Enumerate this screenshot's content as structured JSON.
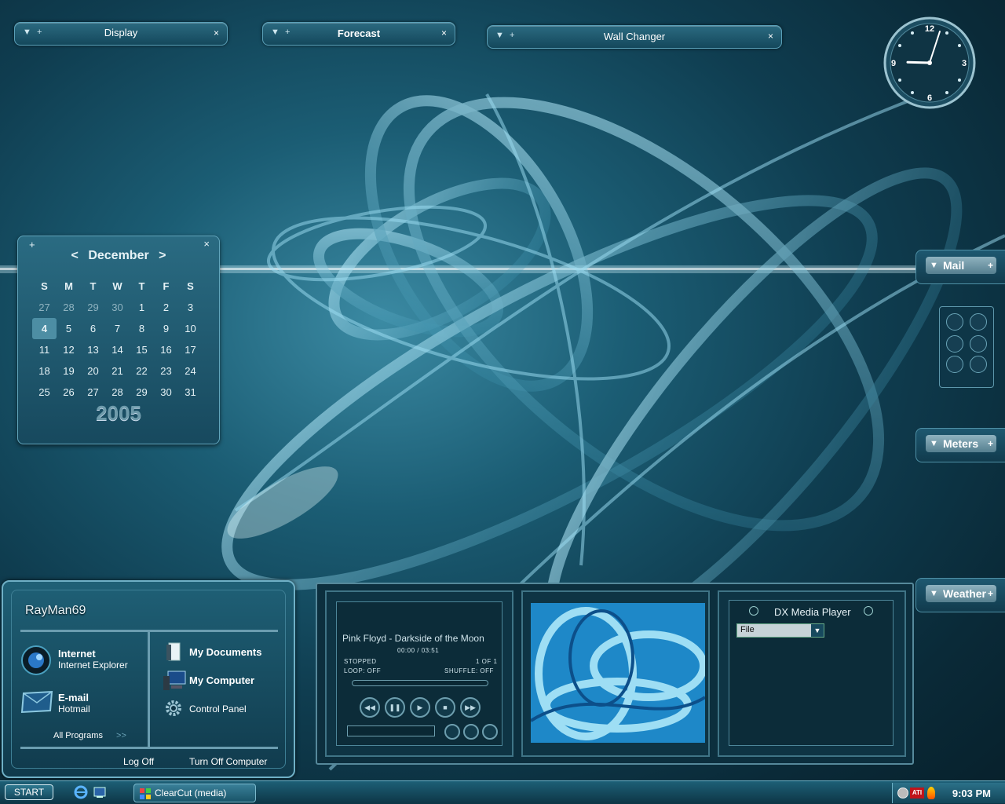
{
  "gadgets": {
    "display": {
      "title": "Display"
    },
    "forecast": {
      "title": "Forecast"
    },
    "wallchanger": {
      "title": "Wall Changer"
    },
    "close_glyph": "×",
    "menu_glyph": "▼",
    "add_glyph": "+"
  },
  "clock": {
    "numerals": [
      "12",
      "3",
      "6",
      "9"
    ],
    "hour": 9,
    "minute": 3
  },
  "calendar": {
    "prev": "<",
    "month": "December",
    "next": ">",
    "year": "2005",
    "weekdays": [
      "S",
      "M",
      "T",
      "W",
      "T",
      "F",
      "S"
    ],
    "weeks": [
      [
        {
          "d": "27",
          "other": true
        },
        {
          "d": "28",
          "other": true
        },
        {
          "d": "29",
          "other": true
        },
        {
          "d": "30",
          "other": true
        },
        {
          "d": "1"
        },
        {
          "d": "2"
        },
        {
          "d": "3"
        }
      ],
      [
        {
          "d": "4",
          "today": true
        },
        {
          "d": "5"
        },
        {
          "d": "6"
        },
        {
          "d": "7"
        },
        {
          "d": "8"
        },
        {
          "d": "9"
        },
        {
          "d": "10"
        }
      ],
      [
        {
          "d": "11"
        },
        {
          "d": "12"
        },
        {
          "d": "13"
        },
        {
          "d": "14"
        },
        {
          "d": "15"
        },
        {
          "d": "16"
        },
        {
          "d": "17"
        }
      ],
      [
        {
          "d": "18"
        },
        {
          "d": "19"
        },
        {
          "d": "20"
        },
        {
          "d": "21"
        },
        {
          "d": "22"
        },
        {
          "d": "23"
        },
        {
          "d": "24"
        }
      ],
      [
        {
          "d": "25"
        },
        {
          "d": "26"
        },
        {
          "d": "27"
        },
        {
          "d": "28"
        },
        {
          "d": "29"
        },
        {
          "d": "30"
        },
        {
          "d": "31"
        }
      ]
    ]
  },
  "docks": {
    "mail": "Mail",
    "meters": "Meters",
    "weather": "Weather"
  },
  "startmenu": {
    "user": "RayMan69",
    "internet": {
      "title": "Internet",
      "sub": "Internet Explorer"
    },
    "email": {
      "title": "E-mail",
      "sub": "Hotmail"
    },
    "all_programs": "All Programs",
    "all_programs_arrow": ">>",
    "my_documents": "My Documents",
    "my_computer": "My Computer",
    "control_panel": "Control Panel",
    "log_off": "Log Off",
    "turn_off": "Turn Off Computer"
  },
  "media": {
    "track": "Pink Floyd - Darkside of the Moon",
    "time": "00:00 / 03:51",
    "status": "STOPPED",
    "count": "1 OF 1",
    "loop": "LOOP: OFF",
    "shuffle": "SHUFFLE: OFF",
    "dx_title": "DX Media Player",
    "dx_select": "File"
  },
  "taskbar": {
    "start": "START",
    "task": "ClearCut (media)",
    "time": "9:03 PM",
    "ati": "ATI"
  },
  "colors": {
    "accent": "#6fb0c6",
    "panel": "#17495e",
    "today": "#4d8ea4"
  }
}
